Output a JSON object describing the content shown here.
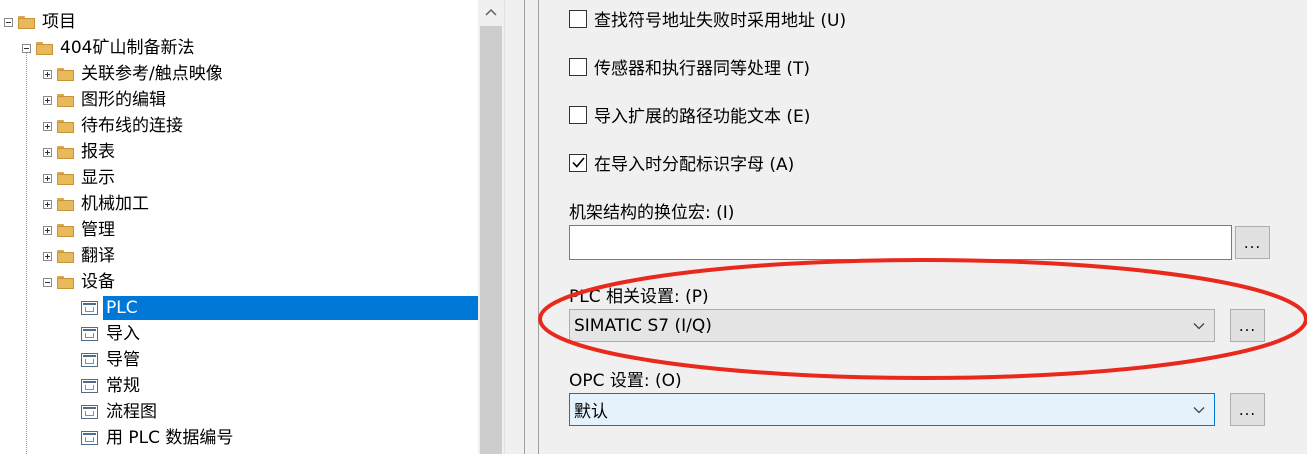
{
  "tree": {
    "nodes": [
      {
        "label": "项目",
        "type": "folder",
        "expander": "minus"
      },
      {
        "label": "404矿山制备新法",
        "type": "folder",
        "expander": "minus"
      },
      {
        "label": "关联参考/触点映像",
        "type": "folder",
        "expander": "plus"
      },
      {
        "label": "图形的编辑",
        "type": "folder",
        "expander": "plus"
      },
      {
        "label": "待布线的连接",
        "type": "folder",
        "expander": "plus"
      },
      {
        "label": "报表",
        "type": "folder",
        "expander": "plus"
      },
      {
        "label": "显示",
        "type": "folder",
        "expander": "plus"
      },
      {
        "label": "机械加工",
        "type": "folder",
        "expander": "plus"
      },
      {
        "label": "管理",
        "type": "folder",
        "expander": "plus"
      },
      {
        "label": "翻译",
        "type": "folder",
        "expander": "plus"
      },
      {
        "label": "设备",
        "type": "folder",
        "expander": "minus"
      },
      {
        "label": "PLC",
        "type": "page",
        "selected": true
      },
      {
        "label": "导入",
        "type": "page"
      },
      {
        "label": "导管",
        "type": "page"
      },
      {
        "label": "常规",
        "type": "page"
      },
      {
        "label": "流程图",
        "type": "page"
      },
      {
        "label": "用 PLC 数据编号",
        "type": "page"
      }
    ]
  },
  "settings": {
    "checkboxes": [
      {
        "label": "查找符号地址失败时采用地址 (U)",
        "checked": false
      },
      {
        "label": "传感器和执行器同等处理 (T)",
        "checked": false
      },
      {
        "label": "导入扩展的路径功能文本 (E)",
        "checked": false
      },
      {
        "label": "在导入时分配标识字母 (A)",
        "checked": true
      }
    ],
    "rack_macro": {
      "label": "机架结构的换位宏: (I)",
      "value": "",
      "browse_label": "..."
    },
    "plc": {
      "label": "PLC 相关设置: (P)",
      "value": "SIMATIC S7 (I/Q)",
      "browse_label": "..."
    },
    "opc": {
      "label": "OPC 设置: (O)",
      "value": "默认",
      "browse_label": "..."
    }
  },
  "annotation": {
    "color": "#e8291c"
  }
}
